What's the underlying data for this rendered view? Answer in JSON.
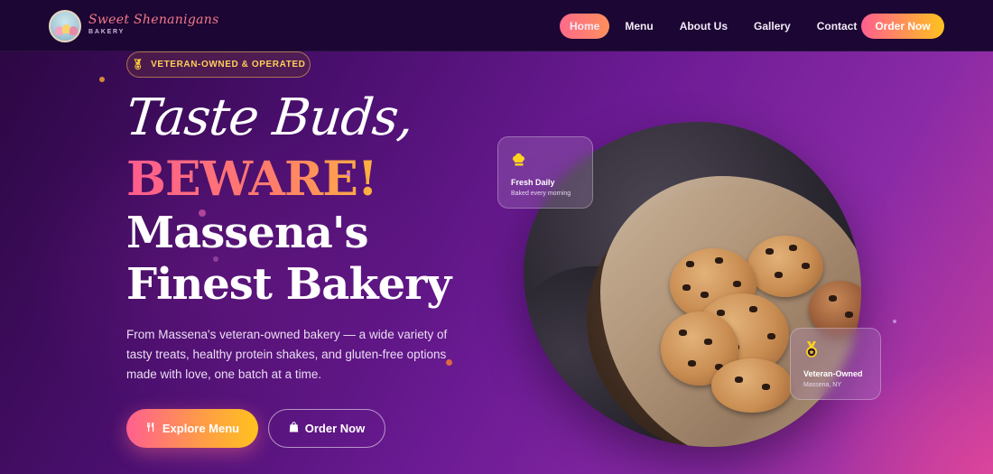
{
  "brand": {
    "name": "Sweet Shenanigans",
    "sub": "BAKERY"
  },
  "nav": {
    "items": [
      {
        "label": "Home",
        "active": true
      },
      {
        "label": "Menu",
        "active": false
      },
      {
        "label": "About Us",
        "active": false
      },
      {
        "label": "Gallery",
        "active": false
      },
      {
        "label": "Contact",
        "active": false
      }
    ],
    "cta": "Order Now"
  },
  "hero": {
    "badge": "VETERAN-OWNED & OPERATED",
    "headline_script": "Taste Buds,",
    "headline_accent": "BEWARE!",
    "headline_line1": "Massena's",
    "headline_line2": "Finest Bakery",
    "description": "From Massena's veteran-owned bakery — a wide variety of tasty treats, healthy protein shakes, and gluten-free options made with love, one batch at a time.",
    "primary_button": "Explore Menu",
    "secondary_button": "Order Now"
  },
  "cards": {
    "fresh": {
      "title": "Fresh Daily",
      "subtitle": "Baked every morning",
      "icon": "chef-hat-icon"
    },
    "veteran": {
      "title": "Veteran-Owned",
      "subtitle": "Massena, NY",
      "icon": "medal-icon"
    }
  },
  "colors": {
    "accent_pink": "#ff5f8f",
    "accent_gold": "#ffc21e",
    "nav_bg": "#1c0633"
  }
}
